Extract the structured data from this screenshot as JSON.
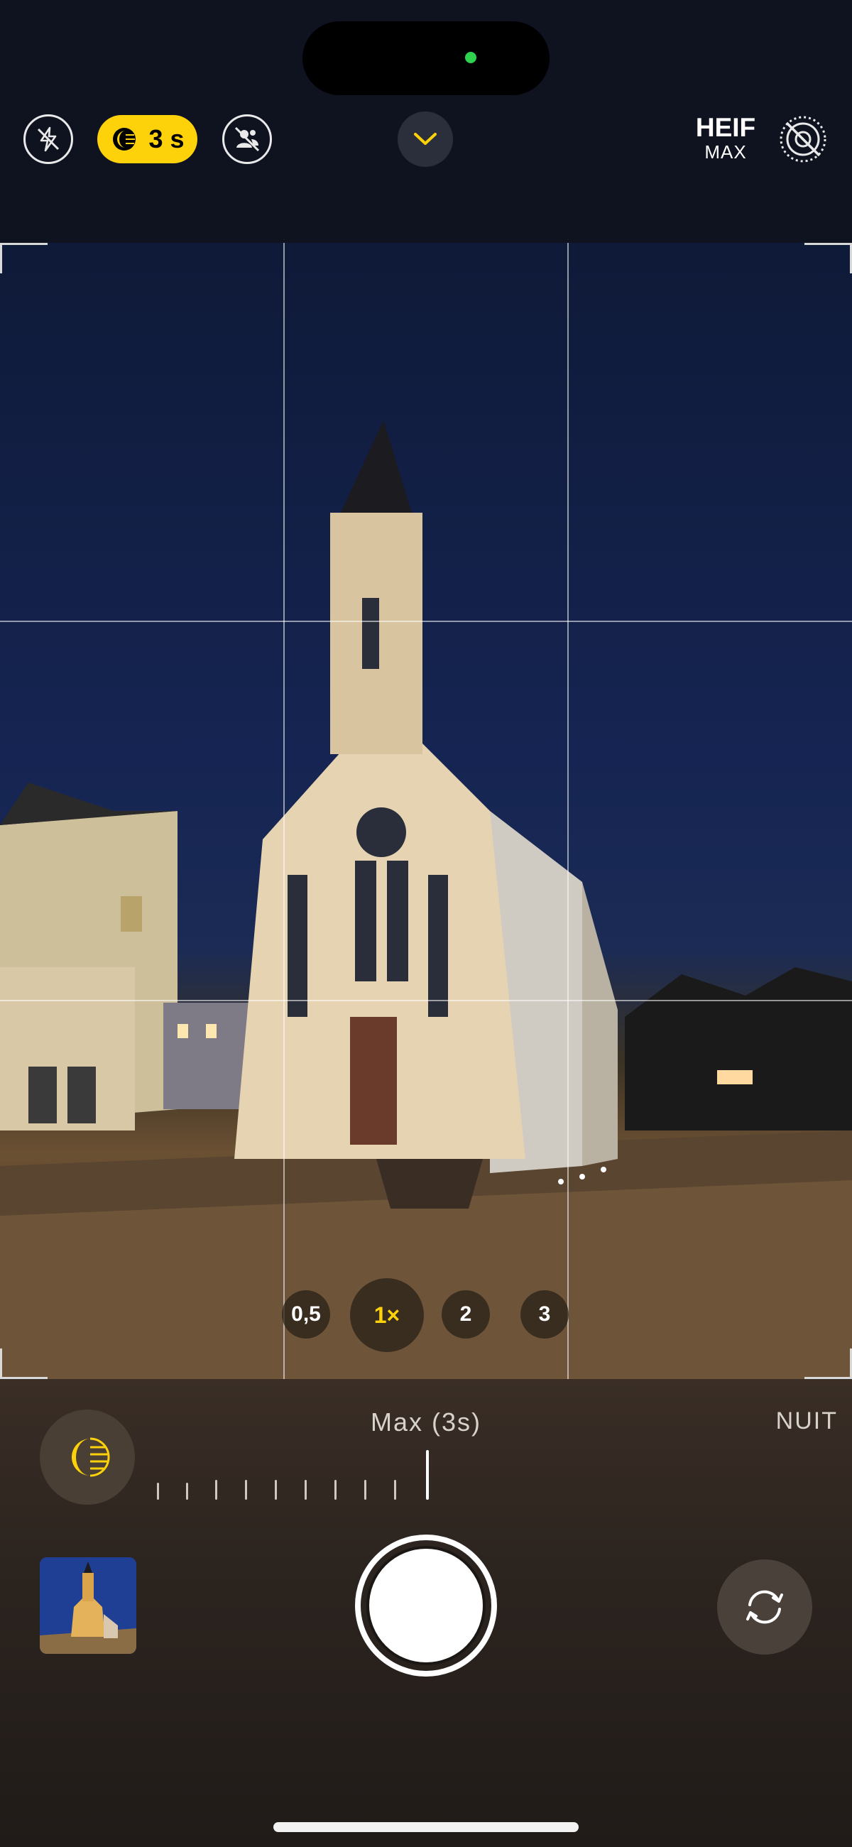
{
  "top_bar": {
    "flash_icon": "flash-off-icon",
    "night_mode": {
      "icon": "night-mode-icon",
      "label": "3 s"
    },
    "live_photo_icon": "live-photo-off-icon",
    "more_controls_icon": "chevron-down-icon",
    "format": {
      "line1": "HEIF",
      "line2": "MAX"
    },
    "live_icon": "live-off-icon",
    "camera_indicator_color": "#2fd24f"
  },
  "viewfinder": {
    "zoom_options": [
      {
        "label": "0,5",
        "selected": false
      },
      {
        "label": "1×",
        "selected": true
      },
      {
        "label": "2",
        "selected": false
      },
      {
        "label": "3",
        "selected": false
      }
    ],
    "selected_zoom_color": "#fdd20a"
  },
  "bottom": {
    "night_toggle_icon": "night-mode-icon",
    "exposure_label": "Max (3s)",
    "mode_label": "NUIT",
    "shutter_icon": "shutter-button",
    "flip_icon": "camera-flip-icon",
    "thumbnail_icon": "last-photo-thumbnail"
  },
  "accent_color": "#fdd20a"
}
